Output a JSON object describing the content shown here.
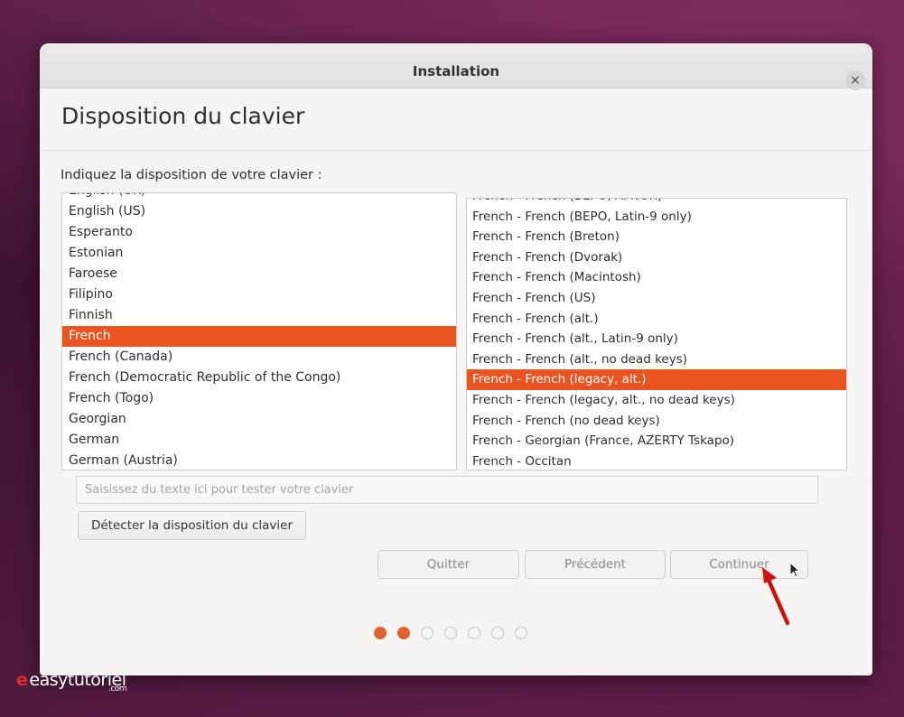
{
  "window": {
    "title": "Installation",
    "close_glyph": "×"
  },
  "page": {
    "title": "Disposition du clavier",
    "prompt": "Indiquez la disposition de votre clavier :"
  },
  "layouts_left": {
    "partial_top": "English (UK)",
    "items": [
      "English (US)",
      "Esperanto",
      "Estonian",
      "Faroese",
      "Filipino",
      "Finnish",
      "French",
      "French (Canada)",
      "French (Democratic Republic of the Congo)",
      "French (Togo)",
      "Georgian",
      "German",
      "German (Austria)"
    ],
    "selected": "French"
  },
  "layouts_right": {
    "partial_top": "French - French (BEPO, AFNOR)",
    "items": [
      "French - French (BEPO, Latin-9 only)",
      "French - French (Breton)",
      "French - French (Dvorak)",
      "French - French (Macintosh)",
      "French - French (US)",
      "French - French (alt.)",
      "French - French (alt., Latin-9 only)",
      "French - French (alt., no dead keys)",
      "French - French (legacy, alt.)",
      "French - French (legacy, alt., no dead keys)",
      "French - French (no dead keys)",
      "French - Georgian (France, AZERTY Tskapo)",
      "French - Occitan"
    ],
    "selected": "French - French (legacy, alt.)"
  },
  "test_input": {
    "placeholder": "Saisissez du texte ici pour tester votre clavier",
    "value": ""
  },
  "buttons": {
    "detect": "Détecter la disposition du clavier",
    "quit": "Quitter",
    "previous": "Précédent",
    "continue": "Continuer"
  },
  "progress": {
    "total_steps": 7,
    "current_step": 2
  },
  "colors": {
    "accent": "#e95420",
    "annotation_arrow": "#d01010"
  },
  "icons": {
    "close": "close-icon",
    "cursor": "mouse-pointer-icon",
    "arrow": "red-arrow-annotation-icon"
  },
  "watermark": {
    "brand": "easytutoriel",
    "suffix": ".com"
  }
}
